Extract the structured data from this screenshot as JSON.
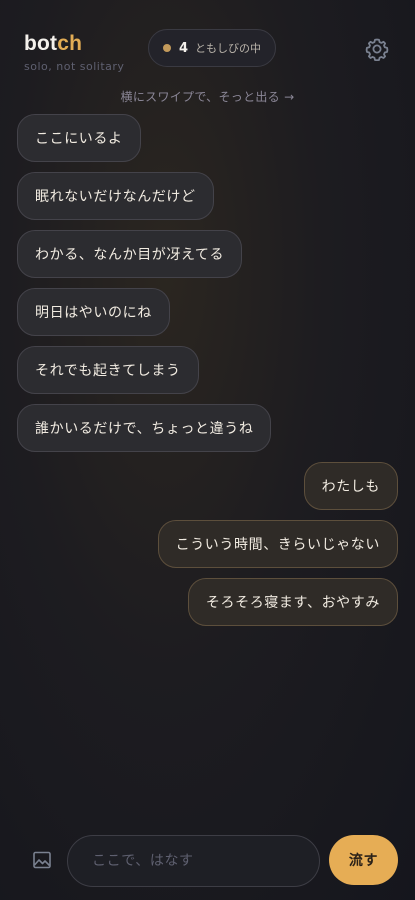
{
  "header": {
    "logo_prefix": "bot",
    "logo_accent": "ch",
    "tagline": "solo, not solitary",
    "presence_count": "4",
    "presence_label": "ともしびの中",
    "settings_icon": "gear-icon"
  },
  "hint": "横にスワイプで、そっと出る →",
  "messages": [
    {
      "text": "ここにいるよ",
      "side": "left"
    },
    {
      "text": "眠れないだけなんだけど",
      "side": "left"
    },
    {
      "text": "わかる、なんか目が冴えてる",
      "side": "left"
    },
    {
      "text": "明日はやいのにね",
      "side": "left"
    },
    {
      "text": "それでも起きてしまう",
      "side": "left"
    },
    {
      "text": "誰かいるだけで、ちょっと違うね",
      "side": "left"
    },
    {
      "text": "わたしも",
      "side": "right"
    },
    {
      "text": "こういう時間、きらいじゃない",
      "side": "right"
    },
    {
      "text": "そろそろ寝ます、おやすみ",
      "side": "right"
    }
  ],
  "composer": {
    "image_icon": "image-icon",
    "placeholder": "ここで、はなす",
    "value": "",
    "send_label": "流す"
  },
  "colors": {
    "accent": "#e6ad55",
    "presence_dot": "#c39a5b",
    "background": "#1b1b20"
  }
}
